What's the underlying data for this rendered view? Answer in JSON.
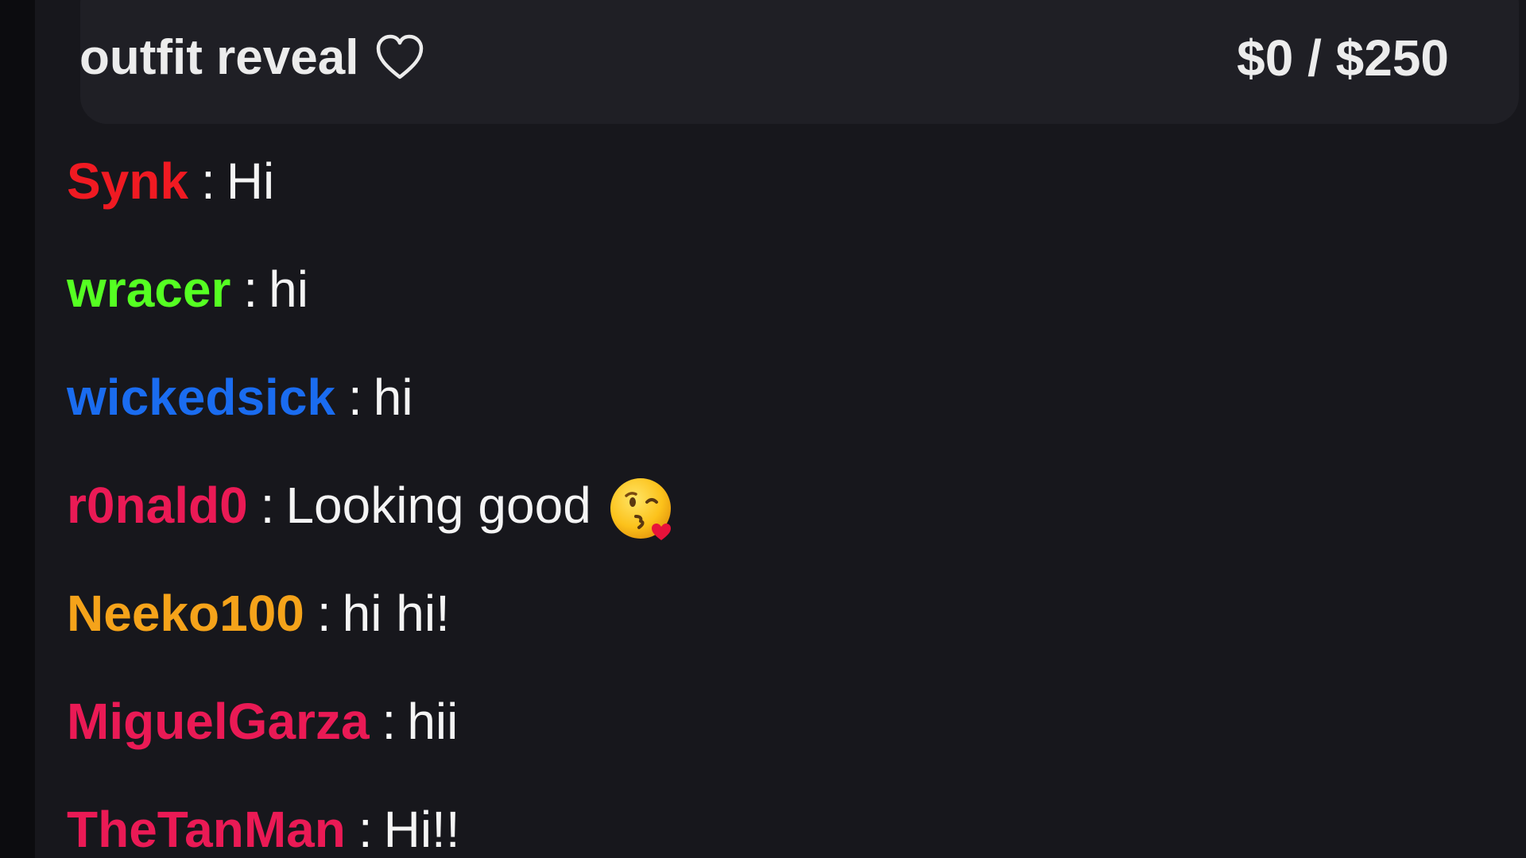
{
  "goal": {
    "title": "outfit reveal",
    "icon": "heart-outline-icon",
    "amount": "$0 / $250"
  },
  "chat": {
    "separator": ":",
    "messages": [
      {
        "user": "Synk",
        "color": "#f01a22",
        "text": "Hi"
      },
      {
        "user": "wracer",
        "color": "#55ff22",
        "text": "hi"
      },
      {
        "user": "wickedsick",
        "color": "#1a6cf0",
        "text": "hi"
      },
      {
        "user": "r0nald0",
        "color": "#ea1a55",
        "text": "Looking good",
        "emoji": "kissing-heart-face-icon"
      },
      {
        "user": "Neeko100",
        "color": "#f5a31a",
        "text": "hi hi!"
      },
      {
        "user": "MiguelGarza",
        "color": "#ea1a55",
        "text": "hii"
      },
      {
        "user": "TheTanMan",
        "color": "#ea1a55",
        "text": "Hi!!"
      }
    ]
  }
}
